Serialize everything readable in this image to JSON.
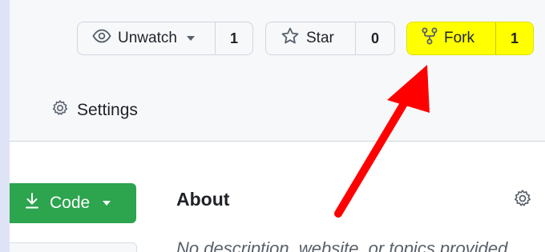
{
  "actions": {
    "watch": {
      "label": "Unwatch",
      "count": "1"
    },
    "star": {
      "label": "Star",
      "count": "0"
    },
    "fork": {
      "label": "Fork",
      "count": "1"
    }
  },
  "nav": {
    "settings_label": "Settings"
  },
  "code_button": {
    "label": "Code"
  },
  "about": {
    "title": "About",
    "description": "No description, website, or topics provided."
  },
  "colors": {
    "highlight": "#ffff00",
    "annotation_arrow": "#ff0000",
    "code_green": "#2da44e"
  },
  "icons": [
    "eye-icon",
    "star-icon",
    "fork-icon",
    "gear-icon",
    "download-icon",
    "caret-down-icon"
  ]
}
